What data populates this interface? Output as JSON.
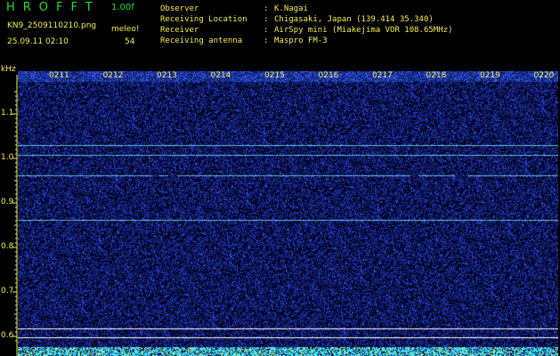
{
  "app": {
    "title": "HROFFT",
    "version": "1.00f"
  },
  "file": {
    "name": "KN9_2509110210.png",
    "datetime": "25.09.11 02:10"
  },
  "meleo": {
    "label": "meleo!",
    "value": "54"
  },
  "info": [
    {
      "label": "Observer",
      "value": "K.Nagai"
    },
    {
      "label": "Receiving Location",
      "value": "Chigasaki, Japan (139.414 35.340)"
    },
    {
      "label": "Receiver",
      "value": "AirSpy mini (Miakejima VOR 108.65MHz)"
    },
    {
      "label": "Receiving antenna",
      "value": "Maspro FM-3"
    }
  ],
  "spectrogram": {
    "y_unit": "kHz",
    "y_ticks": [
      "1.1",
      "1.0",
      "0.9",
      "0.8",
      "0.7",
      "0.6"
    ],
    "x_ticks": [
      "0211",
      "0212",
      "0213",
      "0214",
      "0215",
      "0216",
      "0217",
      "0218",
      "0219",
      "0220"
    ],
    "ylim": [
      0.585,
      1.15
    ],
    "tone_lines_khz": [
      1.03,
      1.008,
      0.962,
      0.862
    ],
    "reference_lines_khz": [
      0.618,
      0.598
    ],
    "colors": {
      "background": "#000000",
      "text": "#f3ef48",
      "title": "#1fe01f",
      "noise": "#2233aa",
      "tone": "#7fd8ff",
      "ref_line": "#ffffff"
    }
  }
}
